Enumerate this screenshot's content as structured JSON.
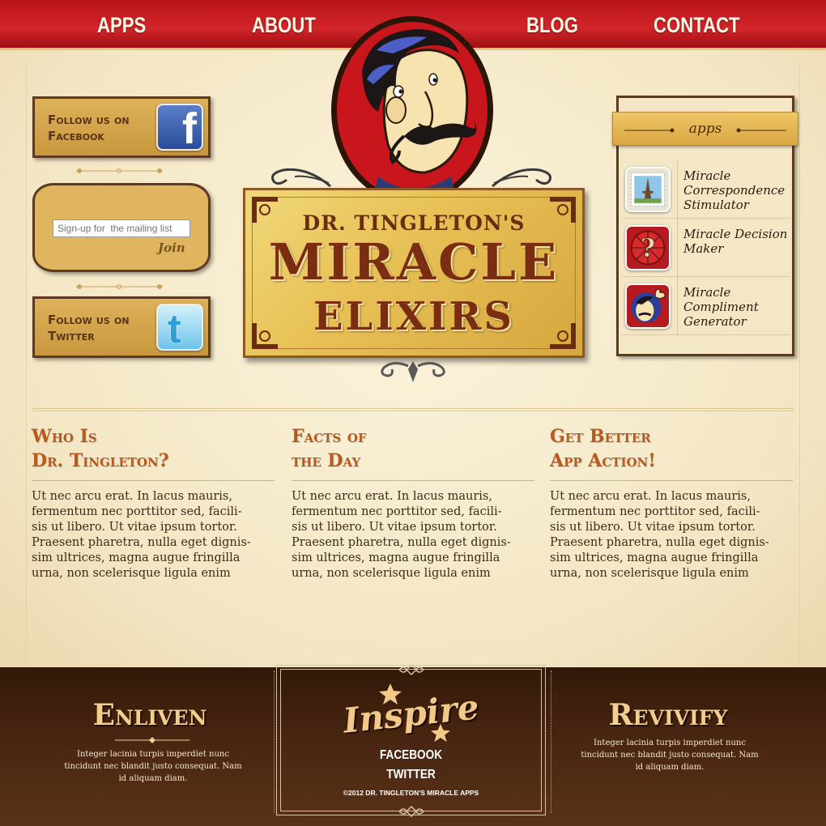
{
  "nav": {
    "items": [
      "APPS",
      "ABOUT",
      "BLOG",
      "CONTACT"
    ]
  },
  "social": {
    "facebook_label": "Follow us on Facebook",
    "twitter_label": "Follow us on Twitter",
    "facebook_glyph": "f",
    "twitter_glyph": "t"
  },
  "mailing": {
    "placeholder": "Sign-up for  the mailing list",
    "button": "Join"
  },
  "logo": {
    "line1": "DR. TINGLETON'S",
    "line2": "MIRACLE",
    "line3": "ELIXIRS"
  },
  "apps_panel": {
    "title": "apps",
    "items": [
      {
        "name": "Miracle Correspondence Stimulator",
        "icon": "postage-stamp-icon"
      },
      {
        "name": "Miracle Decision Maker",
        "icon": "question-mark-icon"
      },
      {
        "name": "Miracle Compliment Generator",
        "icon": "thumbs-up-doctor-icon"
      }
    ]
  },
  "columns": [
    {
      "heading_line1": "Who Is",
      "heading_line2": "Dr. Tingleton?",
      "body": "Ut nec arcu erat. In lacus mauris, fermentum nec porttitor sed, facili- sis ut libero. Ut vitae ipsum tortor. Praesent pharetra, nulla eget dignis- sim ultrices, magna augue fringilla urna, non scelerisque ligula enim"
    },
    {
      "heading_line1": "Facts of",
      "heading_line2": "the Day",
      "body": "Ut nec arcu erat. In lacus mauris, fermentum nec porttitor sed, facili- sis ut libero. Ut vitae ipsum tortor. Praesent pharetra, nulla eget dignis- sim ultrices, magna augue fringilla urna, non scelerisque ligula enim"
    },
    {
      "heading_line1": "Get Better",
      "heading_line2": "App Action!",
      "body": "Ut nec arcu erat. In lacus mauris, fermentum nec porttitor sed, facili- sis ut libero. Ut vitae ipsum tortor. Praesent pharetra, nulla eget dignis- sim ultrices, magna augue fringilla urna, non scelerisque ligula enim"
    }
  ],
  "footer": {
    "left_heading": "Enliven",
    "left_text": "Integer lacinia turpis imperdiet nunc tincidunt nec blandit justo consequat. Nam id aliquam diam.",
    "center_word": "Inspire",
    "link_facebook": "FACEBOOK",
    "link_twitter": "TWITTER",
    "copyright": "©2012 DR. TINGLETON'S MIRACLE APPS",
    "right_heading": "Revivify",
    "right_text": "Integer lacinia turpis imperdiet nunc tincidunt nec blandit justo consequat. Nam id aliquam diam."
  },
  "colors": {
    "nav_red": "#c41a1f",
    "gold": "#dfb55f",
    "brown": "#5d3a20",
    "heading_orange": "#b55a20",
    "footer_brown": "#4a2712"
  }
}
